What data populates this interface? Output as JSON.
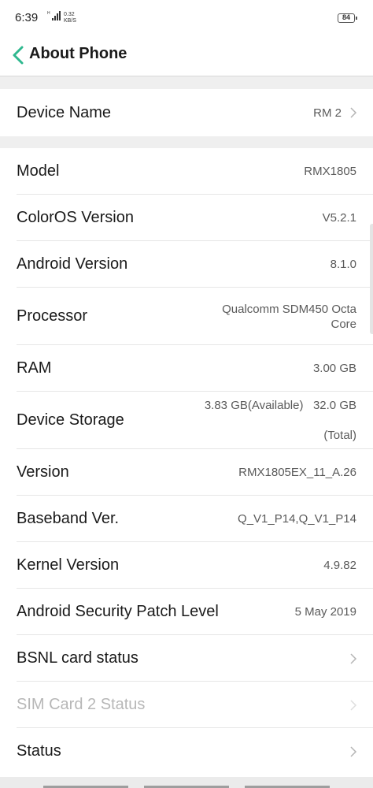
{
  "status_bar": {
    "time": "6:39",
    "network_type": "H",
    "speed_value": "0.32",
    "speed_unit": "KB/S",
    "battery": "84"
  },
  "header": {
    "title": "About Phone",
    "back_icon": "chevron-left-icon",
    "accent_color": "#2fb88f"
  },
  "device_name": {
    "label": "Device Name",
    "value": "RM 2"
  },
  "info_items": [
    {
      "label": "Model",
      "value": "RMX1805"
    },
    {
      "label": "ColorOS Version",
      "value": "V5.2.1"
    },
    {
      "label": "Android Version",
      "value": "8.1.0"
    },
    {
      "label": "Processor",
      "value_line1": "Qualcomm  SDM450 Octa",
      "value_line2": "Core"
    },
    {
      "label": "RAM",
      "value": "3.00 GB"
    },
    {
      "label": "Device Storage",
      "value_line1": "3.83 GB(Available)   32.0 GB",
      "value_line2": "(Total)"
    },
    {
      "label": "Version",
      "value": "RMX1805EX_11_A.26"
    },
    {
      "label": "Baseband Ver.",
      "value": "Q_V1_P14,Q_V1_P14"
    },
    {
      "label": "Kernel Version",
      "value": "4.9.82"
    },
    {
      "label": "Android Security Patch Level",
      "value": "5 May 2019"
    }
  ],
  "nav_items": [
    {
      "label": "BSNL card status",
      "enabled": true
    },
    {
      "label": "SIM Card 2 Status",
      "enabled": false
    },
    {
      "label": "Status",
      "enabled": true
    }
  ]
}
